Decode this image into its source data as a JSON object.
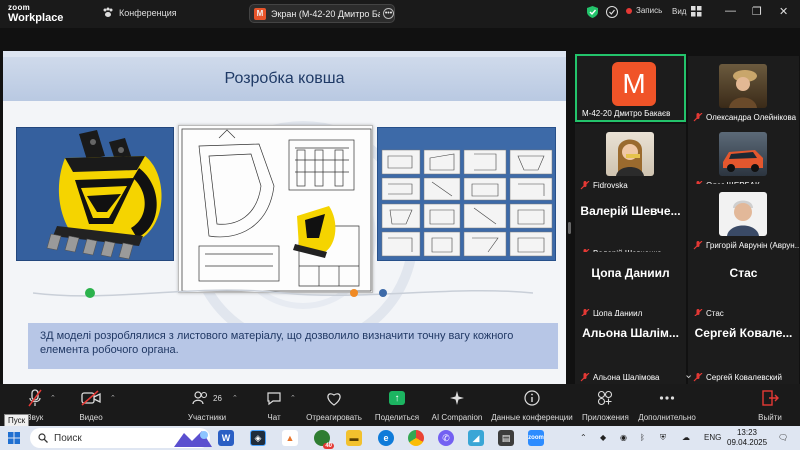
{
  "titlebar": {
    "logo_line1": "zoom",
    "logo_line2": "Workplace",
    "conference_label": "Конференция",
    "screen_chip_badge": "M",
    "screen_chip_label": "Экран (М-42-20 Дмитро Бакаєв",
    "record_label": "Запись",
    "view_label": "Вид",
    "icons": [
      "shield-icon",
      "security-check-icon",
      "record-dot-icon",
      "grid-view-icon",
      "minimize-icon",
      "restore-icon",
      "close-icon"
    ]
  },
  "slide": {
    "title": "Розробка ковша",
    "caption": "3Д моделі розроблялися з листового матеріалу, що дозволило визначити точну вагу кожного елемента робочого органа.",
    "colors": {
      "title_band": "#b9c9e2",
      "caption_box": "#b7c6e6",
      "title_text": "#1f3a66",
      "bucket_yellow": "#f5d400"
    }
  },
  "participants": [
    {
      "name": "М-42-20 Дмитро Бакаєв",
      "avatar_letter": "М",
      "active": true,
      "muted": false,
      "photo": false
    },
    {
      "name": "Олександра Олейнікова",
      "muted": true,
      "photo": true
    },
    {
      "name": "Fidrovska",
      "muted": true,
      "photo": true
    },
    {
      "name": "Олег ЩЕРБАК",
      "muted": true,
      "photo": true
    },
    {
      "name": "Валерій Шевченко",
      "display": "Валерій Шевче...",
      "muted": true,
      "photo": false
    },
    {
      "name": "Григорій Аврунін (Аврун...",
      "muted": true,
      "photo": true
    },
    {
      "name": "Цопа Даниил",
      "display": "Цопа Даниил",
      "muted": true,
      "photo": false
    },
    {
      "name": "Стас",
      "display": "Стас",
      "muted": true,
      "photo": false
    },
    {
      "name": "Альона Шалімова",
      "display": "Альона Шалім...",
      "muted": true,
      "photo": false
    },
    {
      "name": "Сергей Ковалевский",
      "display": "Сергей Ковале...",
      "muted": true,
      "photo": false
    }
  ],
  "toolbar": {
    "audio": "Звук",
    "video": "Видео",
    "participants_count": "26",
    "participants": "Участники",
    "chat": "Чат",
    "react": "Отреагировать",
    "share": "Поделиться",
    "ai": "AI Companion",
    "info": "Данные конференции",
    "apps": "Приложения",
    "more": "Дополнительно",
    "leave": "Выйти",
    "tooltip": "Пуск"
  },
  "taskbar": {
    "search_placeholder": "Поиск",
    "language": "ENG",
    "time": "13:23",
    "date": "09.04.2025",
    "notification_badge": "40"
  }
}
